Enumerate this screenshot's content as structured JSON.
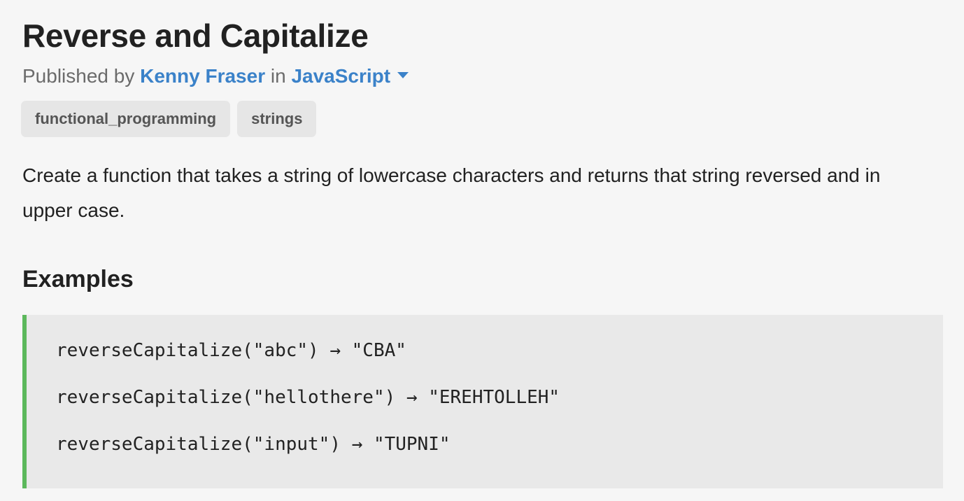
{
  "challenge": {
    "title": "Reverse and Capitalize",
    "byline": {
      "prefix": "Published by",
      "author": "Kenny Fraser",
      "connector": "in",
      "language": "JavaScript"
    },
    "tags": [
      "functional_programming",
      "strings"
    ],
    "description": "Create a function that takes a string of lowercase characters and returns that string reversed and in upper case."
  },
  "examples": {
    "heading": "Examples",
    "lines": [
      "reverseCapitalize(\"abc\") → \"CBA\"",
      "reverseCapitalize(\"hellothere\") → \"EREHTOLLEH\"",
      "reverseCapitalize(\"input\") → \"TUPNI\""
    ]
  },
  "colors": {
    "background": "#f6f6f6",
    "link": "#3b82c9",
    "tag_background": "#e6e6e6",
    "code_background": "#e9e9e9",
    "code_accent": "#5cb85c"
  },
  "icons": {
    "language_dropdown": "caret-down-icon"
  }
}
